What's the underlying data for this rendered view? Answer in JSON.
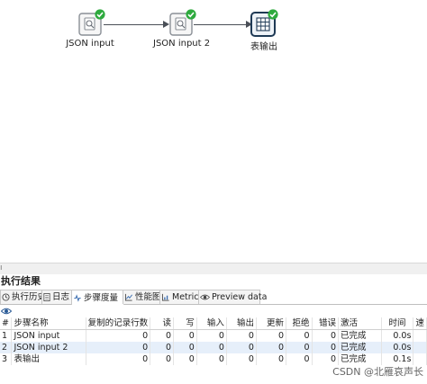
{
  "canvas": {
    "steps": [
      {
        "label": "JSON input",
        "type": "json",
        "status": "success"
      },
      {
        "label": "JSON input 2",
        "type": "json",
        "status": "success"
      },
      {
        "label": "表输出",
        "type": "table",
        "status": "success",
        "selected": true
      }
    ]
  },
  "panel": {
    "edge_char": "ı",
    "title": "执行结果",
    "tabs": [
      {
        "label": "执行历史",
        "icon": "history-icon"
      },
      {
        "label": "日志",
        "icon": "log-icon"
      },
      {
        "label": "步骤度量",
        "icon": "metrics-table-icon",
        "active": true
      },
      {
        "label": "性能图",
        "icon": "chart-icon"
      },
      {
        "label": "Metrics",
        "icon": "metrics-icon"
      },
      {
        "label": "Preview data",
        "icon": "eye-icon"
      }
    ],
    "toolbar": {
      "icon": "eye-icon"
    },
    "table": {
      "headers": [
        "#",
        "步骤名称",
        "复制的记录行数",
        "读",
        "写",
        "输入",
        "输出",
        "更新",
        "拒绝",
        "错误",
        "激活",
        "时间",
        "速"
      ],
      "rows": [
        [
          "1",
          "JSON input",
          "0",
          "0",
          "0",
          "0",
          "0",
          "0",
          "0",
          "0",
          "已完成",
          "0.0s",
          ""
        ],
        [
          "2",
          "JSON input 2",
          "0",
          "0",
          "0",
          "0",
          "0",
          "0",
          "0",
          "0",
          "已完成",
          "0.0s",
          ""
        ],
        [
          "3",
          "表输出",
          "0",
          "0",
          "0",
          "0",
          "0",
          "0",
          "0",
          "0",
          "已完成",
          "0.1s",
          ""
        ]
      ]
    },
    "watermark": "CSDN @北雁哀声长"
  },
  "colors": {
    "success": "#2eaa3e",
    "hop": "#4a4f57",
    "selected_row": "#e6effa"
  }
}
